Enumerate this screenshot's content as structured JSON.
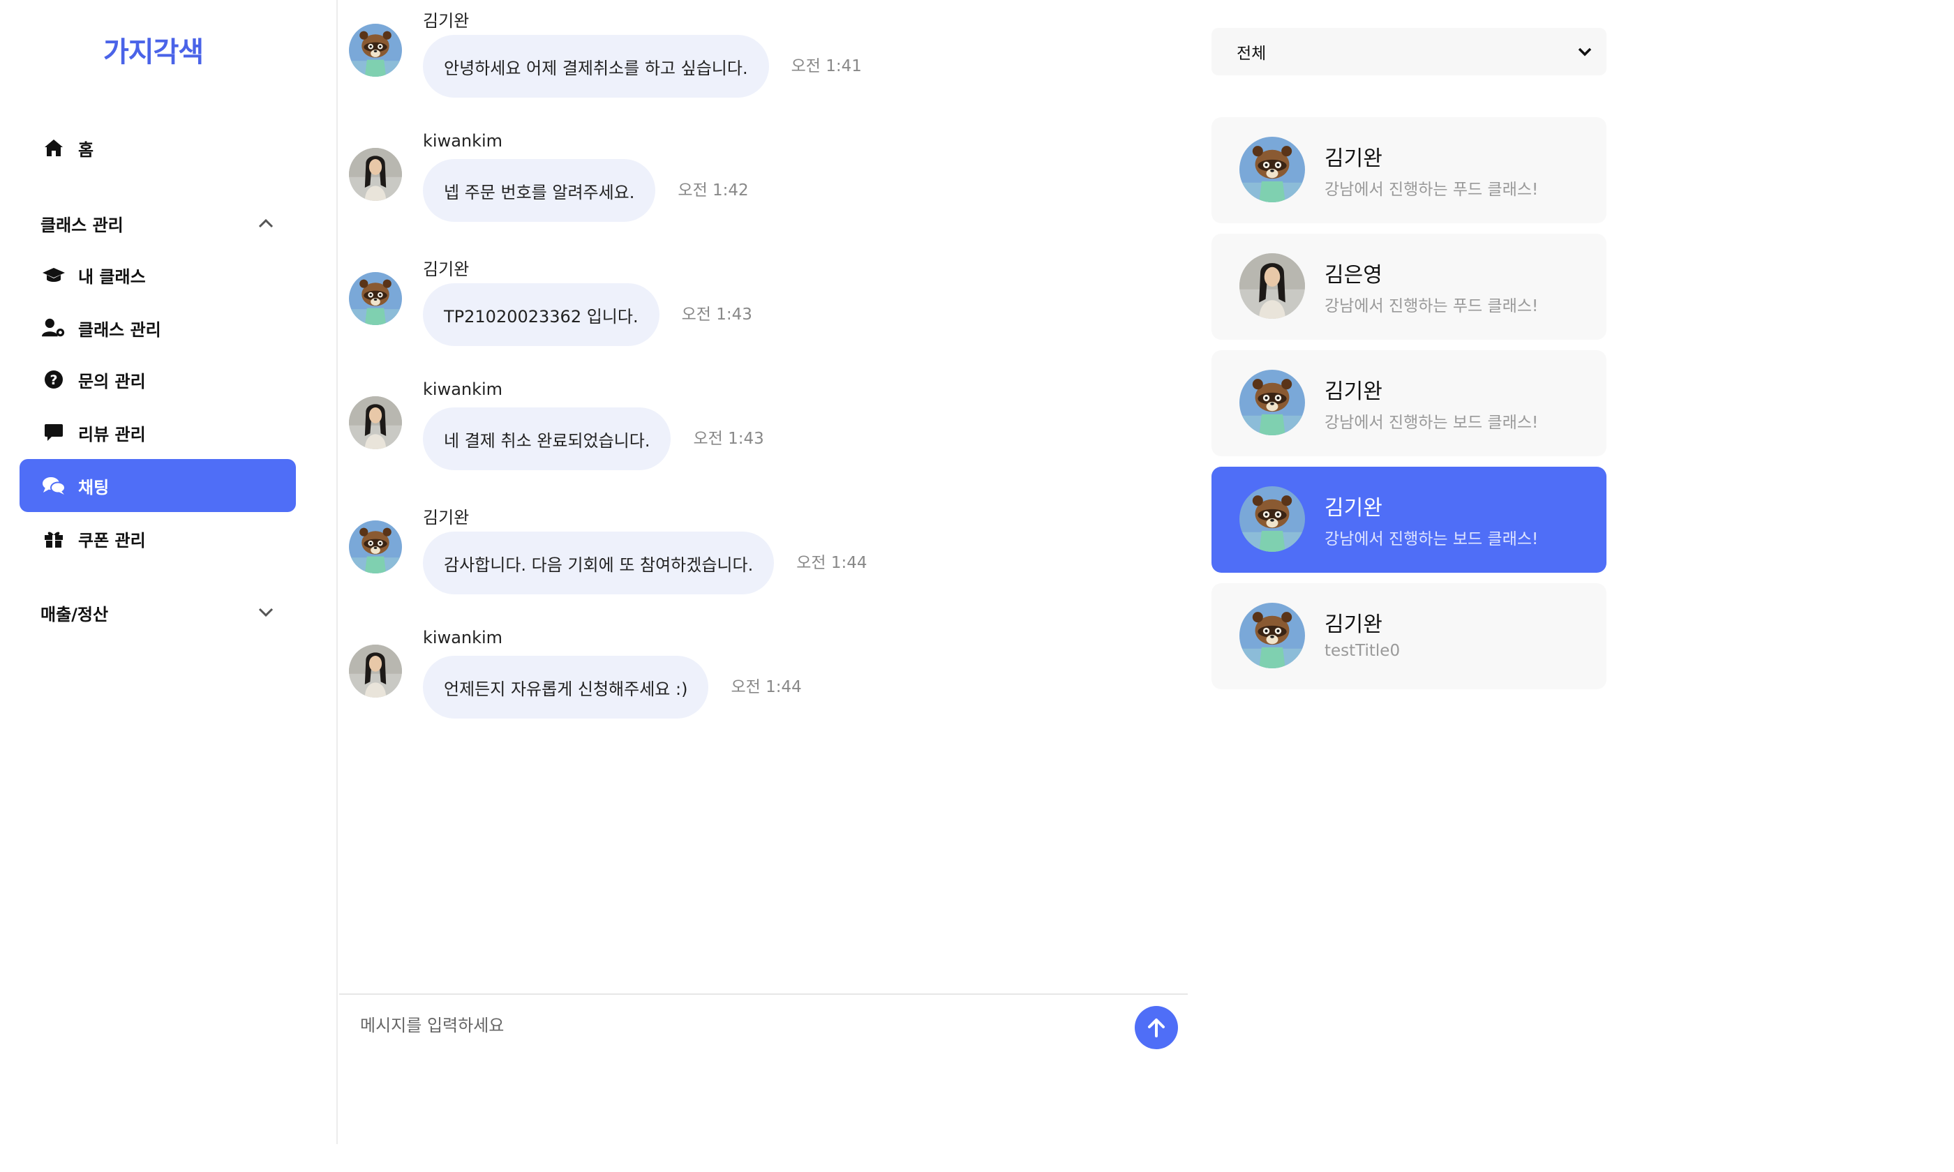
{
  "app": {
    "logo": "가지각색"
  },
  "sidebar": {
    "home": "홈",
    "class_section": "클래스 관리",
    "my_class": "내 클래스",
    "class_manage": "클래스 관리",
    "inquiry": "문의 관리",
    "review": "리뷰 관리",
    "chat": "채팅",
    "coupon": "쿠폰 관리",
    "sales_section": "매출/정산"
  },
  "messages": [
    {
      "sender": "김기완",
      "text": "안녕하세요 어제 결제취소를 하고 싶습니다.",
      "time": "오전 1:41",
      "avatar": "raccoon-avatar"
    },
    {
      "sender": "kiwankim",
      "text": "넵 주문 번호를 알려주세요.",
      "time": "오전 1:42",
      "avatar": "person-avatar"
    },
    {
      "sender": "김기완",
      "text": "TP21020023362 입니다.",
      "time": "오전 1:43",
      "avatar": "raccoon-avatar"
    },
    {
      "sender": "kiwankim",
      "text": "네 결제 취소 완료되었습니다.",
      "time": "오전 1:43",
      "avatar": "person-avatar"
    },
    {
      "sender": "김기완",
      "text": "감사합니다. 다음 기회에 또 참여하겠습니다.",
      "time": "오전 1:44",
      "avatar": "raccoon-avatar"
    },
    {
      "sender": "kiwankim",
      "text": "언제든지 자유롭게 신청해주세요 :)",
      "time": "오전 1:44",
      "avatar": "person-avatar"
    }
  ],
  "input": {
    "placeholder": "메시지를 입력하세요"
  },
  "filter": {
    "selected": "전체"
  },
  "rooms": [
    {
      "name": "김기완",
      "subtitle": "강남에서 진행하는 푸드 클래스!",
      "active": false
    },
    {
      "name": "김은영",
      "subtitle": "강남에서 진행하는 푸드 클래스!",
      "active": false
    },
    {
      "name": "김기완",
      "subtitle": "강남에서 진행하는 보드 클래스!",
      "active": false
    },
    {
      "name": "김기완",
      "subtitle": "강남에서 진행하는 보드 클래스!",
      "active": true
    },
    {
      "name": "김기완",
      "subtitle": "testTitle0",
      "active": false
    }
  ],
  "colors": {
    "accent": "#4f6ef7",
    "bubble": "#eef1fb",
    "logo": "#4a63e8"
  }
}
